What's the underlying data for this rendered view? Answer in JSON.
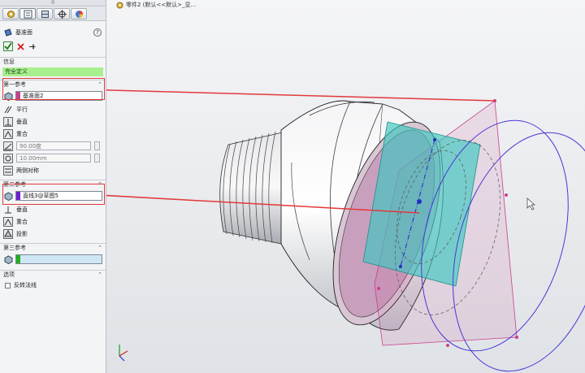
{
  "breadcrumb": "零件2 (默认<<默认>_显...",
  "panel": {
    "top_marker": "0",
    "title": "基准面",
    "help": "?",
    "message_section": "信息",
    "status": "完全定义",
    "first_ref": {
      "header": "第一参考",
      "value": "基准面2",
      "swatch": "#c9408c",
      "options": [
        "平行",
        "垂直",
        "重合"
      ],
      "angle": "90.00度",
      "distance": "10.00mm",
      "symmetric": "两侧对称"
    },
    "second_ref": {
      "header": "第二参考",
      "value": "直线3@草图5",
      "swatch": "#7020d0",
      "options": [
        "垂直",
        "重合",
        "投影"
      ]
    },
    "third_ref": {
      "header": "第三参考",
      "value": "",
      "swatch": "#20b020"
    },
    "options_section": "选项",
    "flip_normal": "反转法线"
  },
  "colors": {
    "status_green": "#a8f08f",
    "annotation_red": "#e13a3a",
    "plane_pink": "#c9408c",
    "plane_cyan": "#3cc7c0"
  }
}
